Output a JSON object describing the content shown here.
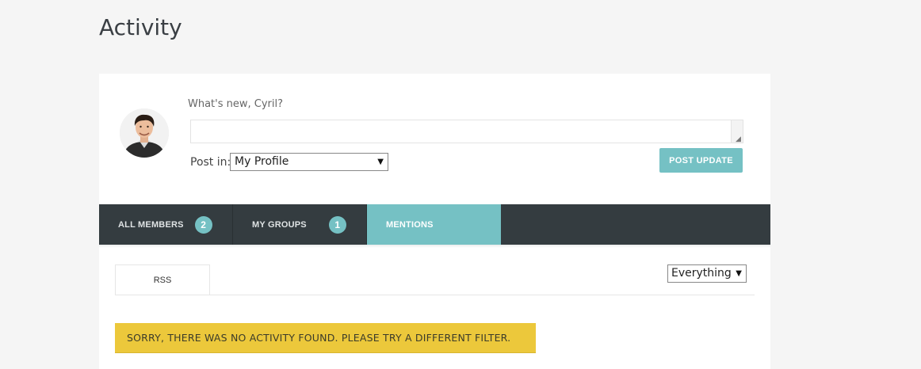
{
  "page": {
    "title": "Activity"
  },
  "post_form": {
    "prompt": "What's new, Cyril?",
    "textarea_value": "",
    "post_in_label": "Post in:",
    "post_in_selected": "My Profile",
    "submit_label": "POST UPDATE",
    "avatar_icon": "user-avatar-photo"
  },
  "tabs": [
    {
      "label": "ALL MEMBERS",
      "count": "2",
      "active": false
    },
    {
      "label": "MY GROUPS",
      "count": "1",
      "active": false
    },
    {
      "label": "MENTIONS",
      "count": null,
      "active": true
    }
  ],
  "subnav": {
    "rss_label": "RSS",
    "filter_selected": "Everything"
  },
  "notice": {
    "message": "SORRY, THERE WAS NO ACTIVITY FOUND. PLEASE TRY A DIFFERENT FILTER."
  },
  "colors": {
    "accent": "#75c1c4",
    "tabbar": "#343c40",
    "notice": "#ecc83b"
  }
}
